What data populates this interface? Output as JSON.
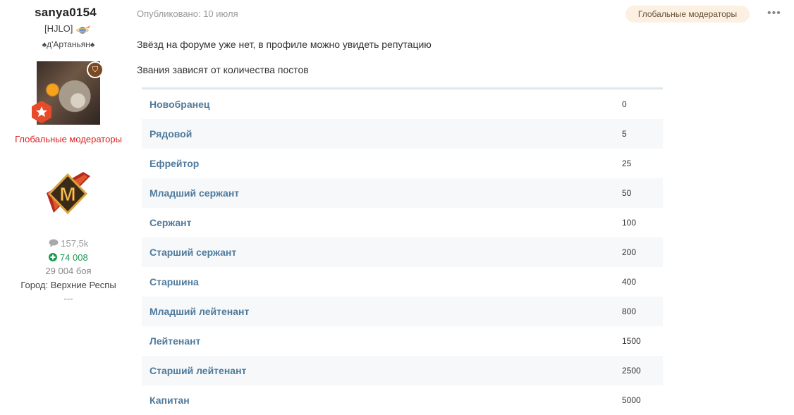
{
  "author": {
    "username": "sanya0154",
    "clan": "[HJLO]",
    "title": "♠д'Артаньян♠",
    "group": "Глобальные модераторы",
    "posts": "157,5k",
    "reputation": "74 008",
    "battles": "29 004 боя",
    "city": "Город: Верхние Респы",
    "separator": "---",
    "badge_letter": "M"
  },
  "post": {
    "published": "Опубликовано: 10 июля",
    "group_tag": "Глобальные модераторы",
    "more": "•••",
    "paragraphs": [
      "Звёзд на форуме уже нет, в профиле можно увидеть репутацию",
      "Звания зависят от количества постов"
    ],
    "ranks": [
      {
        "name": "Новобранец",
        "posts": "0"
      },
      {
        "name": "Рядовой",
        "posts": "5"
      },
      {
        "name": "Ефрейтор",
        "posts": "25"
      },
      {
        "name": "Младший сержант",
        "posts": "50"
      },
      {
        "name": "Сержант",
        "posts": "100"
      },
      {
        "name": "Старший сержант",
        "posts": "200"
      },
      {
        "name": "Старшина",
        "posts": "400"
      },
      {
        "name": "Младший лейтенант",
        "posts": "800"
      },
      {
        "name": "Лейтенант",
        "posts": "1500"
      },
      {
        "name": "Старший лейтенант",
        "posts": "2500"
      },
      {
        "name": "Капитан",
        "posts": "5000"
      }
    ]
  },
  "colors": {
    "group_red": "#dd2222",
    "rank_blue": "#4f7a9c",
    "rep_green": "#1a9b51",
    "tag_bg": "#fbf0e1"
  },
  "icons": {
    "planet": "planet-icon",
    "shield": "shield-icon",
    "star": "star-icon",
    "comment": "comment-icon",
    "plus": "plus-circle-icon"
  }
}
